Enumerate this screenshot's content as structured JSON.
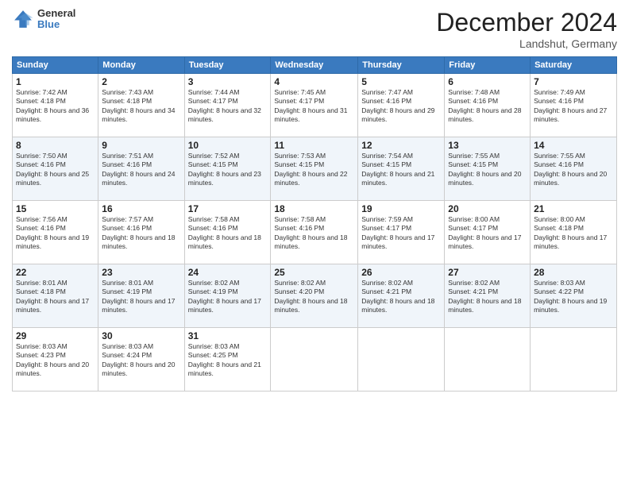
{
  "header": {
    "logo_general": "General",
    "logo_blue": "Blue",
    "month_title": "December 2024",
    "location": "Landshut, Germany"
  },
  "days_of_week": [
    "Sunday",
    "Monday",
    "Tuesday",
    "Wednesday",
    "Thursday",
    "Friday",
    "Saturday"
  ],
  "weeks": [
    [
      {
        "day": 1,
        "sunrise": "7:42 AM",
        "sunset": "4:18 PM",
        "daylight": "8 hours and 36 minutes."
      },
      {
        "day": 2,
        "sunrise": "7:43 AM",
        "sunset": "4:18 PM",
        "daylight": "8 hours and 34 minutes."
      },
      {
        "day": 3,
        "sunrise": "7:44 AM",
        "sunset": "4:17 PM",
        "daylight": "8 hours and 32 minutes."
      },
      {
        "day": 4,
        "sunrise": "7:45 AM",
        "sunset": "4:17 PM",
        "daylight": "8 hours and 31 minutes."
      },
      {
        "day": 5,
        "sunrise": "7:47 AM",
        "sunset": "4:16 PM",
        "daylight": "8 hours and 29 minutes."
      },
      {
        "day": 6,
        "sunrise": "7:48 AM",
        "sunset": "4:16 PM",
        "daylight": "8 hours and 28 minutes."
      },
      {
        "day": 7,
        "sunrise": "7:49 AM",
        "sunset": "4:16 PM",
        "daylight": "8 hours and 27 minutes."
      }
    ],
    [
      {
        "day": 8,
        "sunrise": "7:50 AM",
        "sunset": "4:16 PM",
        "daylight": "8 hours and 25 minutes."
      },
      {
        "day": 9,
        "sunrise": "7:51 AM",
        "sunset": "4:16 PM",
        "daylight": "8 hours and 24 minutes."
      },
      {
        "day": 10,
        "sunrise": "7:52 AM",
        "sunset": "4:15 PM",
        "daylight": "8 hours and 23 minutes."
      },
      {
        "day": 11,
        "sunrise": "7:53 AM",
        "sunset": "4:15 PM",
        "daylight": "8 hours and 22 minutes."
      },
      {
        "day": 12,
        "sunrise": "7:54 AM",
        "sunset": "4:15 PM",
        "daylight": "8 hours and 21 minutes."
      },
      {
        "day": 13,
        "sunrise": "7:55 AM",
        "sunset": "4:15 PM",
        "daylight": "8 hours and 20 minutes."
      },
      {
        "day": 14,
        "sunrise": "7:55 AM",
        "sunset": "4:16 PM",
        "daylight": "8 hours and 20 minutes."
      }
    ],
    [
      {
        "day": 15,
        "sunrise": "7:56 AM",
        "sunset": "4:16 PM",
        "daylight": "8 hours and 19 minutes."
      },
      {
        "day": 16,
        "sunrise": "7:57 AM",
        "sunset": "4:16 PM",
        "daylight": "8 hours and 18 minutes."
      },
      {
        "day": 17,
        "sunrise": "7:58 AM",
        "sunset": "4:16 PM",
        "daylight": "8 hours and 18 minutes."
      },
      {
        "day": 18,
        "sunrise": "7:58 AM",
        "sunset": "4:16 PM",
        "daylight": "8 hours and 18 minutes."
      },
      {
        "day": 19,
        "sunrise": "7:59 AM",
        "sunset": "4:17 PM",
        "daylight": "8 hours and 17 minutes."
      },
      {
        "day": 20,
        "sunrise": "8:00 AM",
        "sunset": "4:17 PM",
        "daylight": "8 hours and 17 minutes."
      },
      {
        "day": 21,
        "sunrise": "8:00 AM",
        "sunset": "4:18 PM",
        "daylight": "8 hours and 17 minutes."
      }
    ],
    [
      {
        "day": 22,
        "sunrise": "8:01 AM",
        "sunset": "4:18 PM",
        "daylight": "8 hours and 17 minutes."
      },
      {
        "day": 23,
        "sunrise": "8:01 AM",
        "sunset": "4:19 PM",
        "daylight": "8 hours and 17 minutes."
      },
      {
        "day": 24,
        "sunrise": "8:02 AM",
        "sunset": "4:19 PM",
        "daylight": "8 hours and 17 minutes."
      },
      {
        "day": 25,
        "sunrise": "8:02 AM",
        "sunset": "4:20 PM",
        "daylight": "8 hours and 18 minutes."
      },
      {
        "day": 26,
        "sunrise": "8:02 AM",
        "sunset": "4:21 PM",
        "daylight": "8 hours and 18 minutes."
      },
      {
        "day": 27,
        "sunrise": "8:02 AM",
        "sunset": "4:21 PM",
        "daylight": "8 hours and 18 minutes."
      },
      {
        "day": 28,
        "sunrise": "8:03 AM",
        "sunset": "4:22 PM",
        "daylight": "8 hours and 19 minutes."
      }
    ],
    [
      {
        "day": 29,
        "sunrise": "8:03 AM",
        "sunset": "4:23 PM",
        "daylight": "8 hours and 20 minutes."
      },
      {
        "day": 30,
        "sunrise": "8:03 AM",
        "sunset": "4:24 PM",
        "daylight": "8 hours and 20 minutes."
      },
      {
        "day": 31,
        "sunrise": "8:03 AM",
        "sunset": "4:25 PM",
        "daylight": "8 hours and 21 minutes."
      },
      null,
      null,
      null,
      null
    ]
  ]
}
